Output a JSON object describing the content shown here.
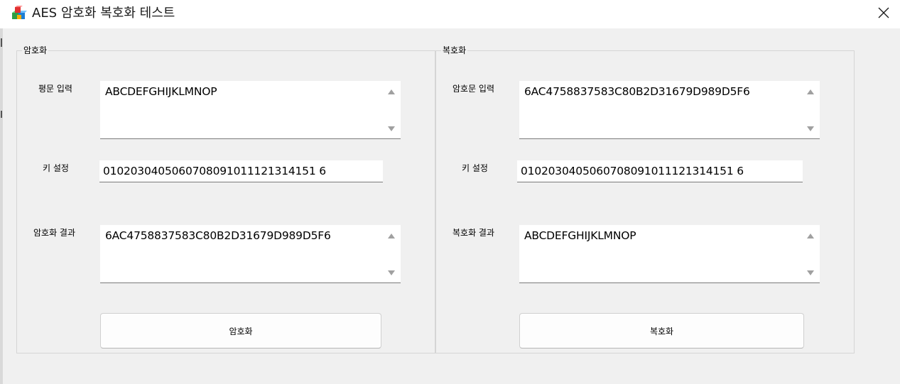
{
  "window": {
    "title": "AES 암호화 복호화 테스트",
    "icon": "app-cubes-icon",
    "close_icon": "close-icon"
  },
  "encrypt": {
    "group_title": "암호화",
    "plaintext_label": "평문 입력",
    "plaintext_value": "ABCDEFGHIJKLMNOP",
    "key_label": "키 설정",
    "key_value": "0102030405060708091011121314151 6",
    "result_label": "암호화 결과",
    "result_value": "6AC4758837583C80B2D31679D989D5F6",
    "button_label": "암호화"
  },
  "decrypt": {
    "group_title": "복호화",
    "ciphertext_label": "암호문 입력",
    "ciphertext_value": "6AC4758837583C80B2D31679D989D5F6",
    "key_label": "키 설정",
    "key_value": "0102030405060708091011121314151 6",
    "result_label": "복호화 결과",
    "result_value": "ABCDEFGHIJKLMNOP",
    "button_label": "복호화"
  },
  "colors": {
    "window_bg": "#f0f0f0",
    "titlebar_bg": "#ffffff",
    "field_bg": "#ffffff"
  }
}
